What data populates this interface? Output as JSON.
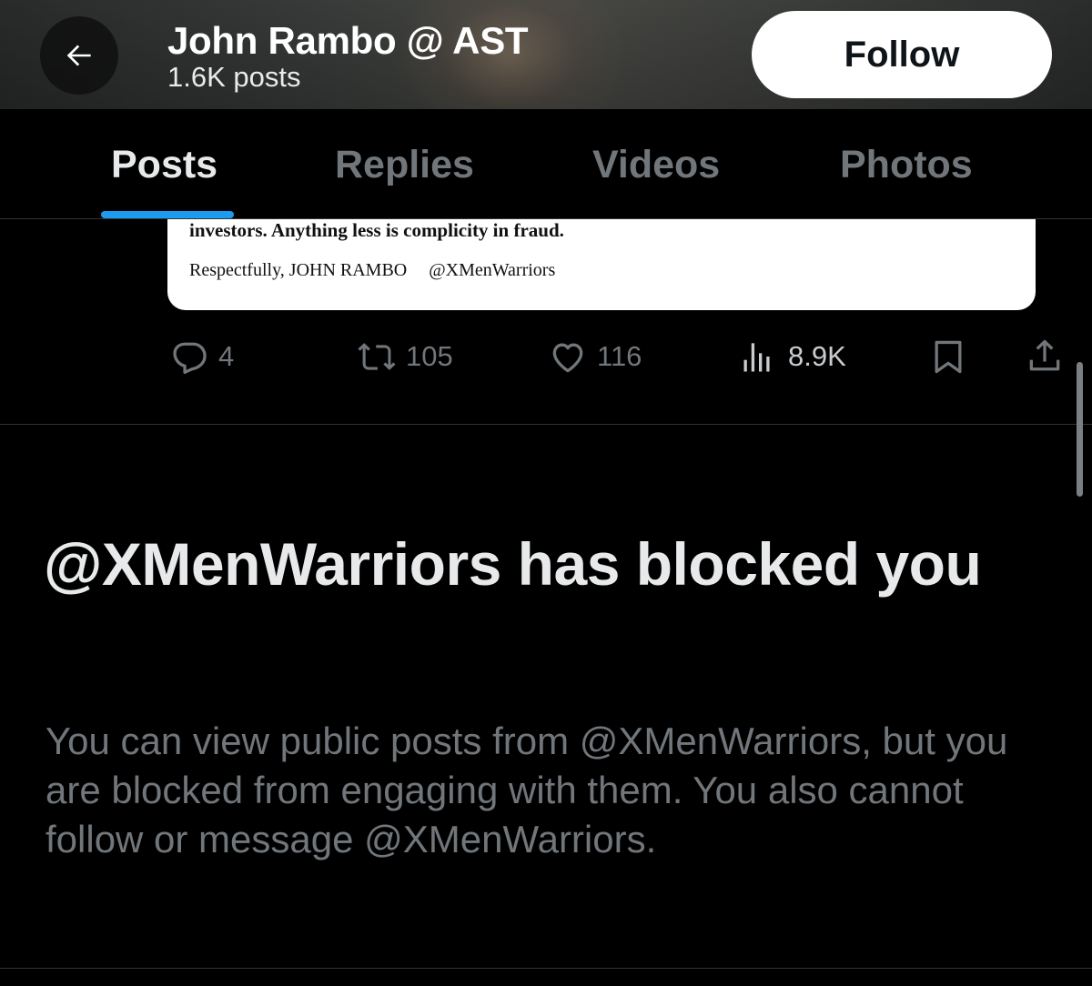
{
  "header": {
    "title": "John Rambo @ AST",
    "subtitle": "1.6K posts",
    "follow_label": "Follow"
  },
  "tabs": [
    {
      "label": "Posts",
      "active": true
    },
    {
      "label": "Replies",
      "active": false
    },
    {
      "label": "Videos",
      "active": false
    },
    {
      "label": "Photos",
      "active": false
    }
  ],
  "post": {
    "image_text_line1": "investors. Anything less is complicity in fraud.",
    "image_signature": "Respectfully, JOHN RAMBO",
    "image_handle": "@XMenWarriors",
    "actions": {
      "replies": "4",
      "reposts": "105",
      "likes": "116",
      "views": "8.9K"
    }
  },
  "blocked": {
    "title": "@XMenWarriors has blocked you",
    "description": "You can view public posts from @XMenWarriors, but you are blocked from engaging with them. You also cannot follow or message @XMenWarriors."
  },
  "colors": {
    "accent": "#1d9bf0",
    "background": "#000000",
    "muted_text": "#71767b",
    "primary_text": "#e7e9ea"
  }
}
